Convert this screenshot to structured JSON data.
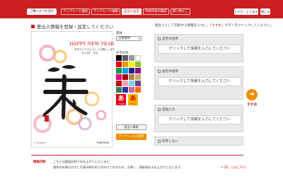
{
  "header": {
    "brand_button": "ご購入までの流れ",
    "steps": [
      "テンプレート選択",
      "テンプレート編集",
      "差出人設定",
      "印刷内容の確認",
      "買い物かご"
    ],
    "active_step": 2,
    "help_button": "ＦＡＱ・よくある質問",
    "close_button": "閉じる"
  },
  "section": {
    "title": "差出人情報を登録・設定してください",
    "instruction_before": "差出人として印刷する情報を入力し、「",
    "instruction_highlight": "すすめ",
    "instruction_after": "」ボタンをクリックしてください。"
  },
  "card": {
    "headline": "HAPPY NEW YEAR",
    "line1": "本年もどうぞよろしくお願いします",
    "line2": "2022年　元旦",
    "footer_left": "C-xxxxxx",
    "footer_right": "FUJIFILM"
  },
  "tools": {
    "font_label": "書体",
    "font_value": "正楷書体",
    "color_label": "文字の色",
    "palette": [
      "#000000",
      "#5a5a5a",
      "#999999",
      "#ffffff",
      "#e60012",
      "#f39800",
      "#fff100",
      "#8fc31f",
      "#009944",
      "#00a0e9",
      "#1d2088",
      "#920783",
      "#e4007f",
      "#a40000",
      "#b28247",
      "#cfa972",
      "#c7000b",
      "#f5a3b5",
      "#7fcdec",
      "#6c3d91",
      "#2e8b57",
      "#333399",
      "#cc6699",
      "#ff6600"
    ],
    "fuchi_label": "フチ",
    "fuchi_on_glyph": "あ",
    "fuchi_on_sub": "フチあり",
    "fuchi_off_glyph": "あ",
    "fuchi_off_sub": "フチなし",
    "add_button": "差出人情報",
    "mypage_button": "マイページに保存"
  },
  "info_boxes": [
    {
      "title": "自宅の住所",
      "prompt": "クリックして情報を入力してください"
    },
    {
      "title": "会社の住所",
      "prompt": "クリックして情報を入力してください"
    },
    {
      "title": "自由入力",
      "prompt": "クリックして情報を入力してください"
    },
    {
      "title": "印字しない",
      "prompt": ""
    }
  ],
  "next": {
    "arrow": "➜",
    "label": "すすめ"
  },
  "notice": {
    "label": "銀塩印刷",
    "line1": "こちらは銀塩印刷での仕上がりになります。",
    "line2": "通常の年賀はがきに写真印刷を貼り合わせて作るため、分厚く、高級感ある仕上がりになります。",
    "detail_link": "⇒ 詳しくはこちら"
  }
}
